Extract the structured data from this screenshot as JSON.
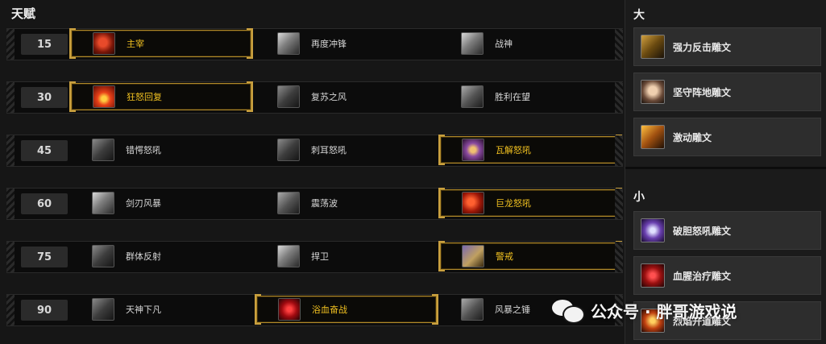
{
  "talents": {
    "title": "天赋",
    "rows": [
      {
        "level": "15",
        "options": [
          {
            "name": "主宰",
            "icon": "red-demon-icon",
            "selected": true
          },
          {
            "name": "再度冲锋",
            "icon": "double-charge-icon",
            "selected": false
          },
          {
            "name": "战神",
            "icon": "war-god-icon",
            "selected": false
          }
        ]
      },
      {
        "level": "30",
        "options": [
          {
            "name": "狂怒回复",
            "icon": "enraged-regeneration-icon",
            "selected": true
          },
          {
            "name": "复苏之风",
            "icon": "second-wind-icon",
            "selected": false
          },
          {
            "name": "胜利在望",
            "icon": "impending-victory-icon",
            "selected": false
          }
        ]
      },
      {
        "level": "45",
        "options": [
          {
            "name": "错愕怒吼",
            "icon": "staggering-shout-icon",
            "selected": false
          },
          {
            "name": "刺耳怒吼",
            "icon": "piercing-howl-icon",
            "selected": false
          },
          {
            "name": "瓦解怒吼",
            "icon": "disrupting-shout-icon",
            "selected": true
          }
        ]
      },
      {
        "level": "60",
        "options": [
          {
            "name": "剑刃风暴",
            "icon": "bladestorm-icon",
            "selected": false
          },
          {
            "name": "震荡波",
            "icon": "shockwave-icon",
            "selected": false
          },
          {
            "name": "巨龙怒吼",
            "icon": "dragon-roar-icon",
            "selected": true
          }
        ]
      },
      {
        "level": "75",
        "options": [
          {
            "name": "群体反射",
            "icon": "mass-reflection-icon",
            "selected": false
          },
          {
            "name": "捍卫",
            "icon": "safeguard-icon",
            "selected": false
          },
          {
            "name": "警戒",
            "icon": "vigilance-icon",
            "selected": true
          }
        ]
      },
      {
        "level": "90",
        "options": [
          {
            "name": "天神下凡",
            "icon": "avatar-icon",
            "selected": false
          },
          {
            "name": "浴血奋战",
            "icon": "bloodbath-icon",
            "selected": true
          },
          {
            "name": "风暴之锤",
            "icon": "storm-bolt-icon",
            "selected": false
          }
        ]
      }
    ]
  },
  "glyphs": {
    "major_title": "大",
    "major": [
      {
        "name": "强力反击雕文",
        "icon": "glyph-counter-icon"
      },
      {
        "name": "坚守阵地雕文",
        "icon": "glyph-last-stand-icon"
      },
      {
        "name": "激动雕文",
        "icon": "glyph-enrage-icon"
      }
    ],
    "minor_title": "小",
    "minor": [
      {
        "name": "破胆怒吼雕文",
        "icon": "glyph-intimidating-shout-icon"
      },
      {
        "name": "血腥治疗雕文",
        "icon": "glyph-bloody-healing-icon"
      },
      {
        "name": "烈焰开道雕文",
        "icon": "glyph-burning-path-icon"
      }
    ]
  },
  "watermark": {
    "text": "公众号 · 胖哥游戏说"
  },
  "colors": {
    "selected_text": "#f0c020",
    "selected_border": "#b18a2a",
    "background": "#161616"
  }
}
